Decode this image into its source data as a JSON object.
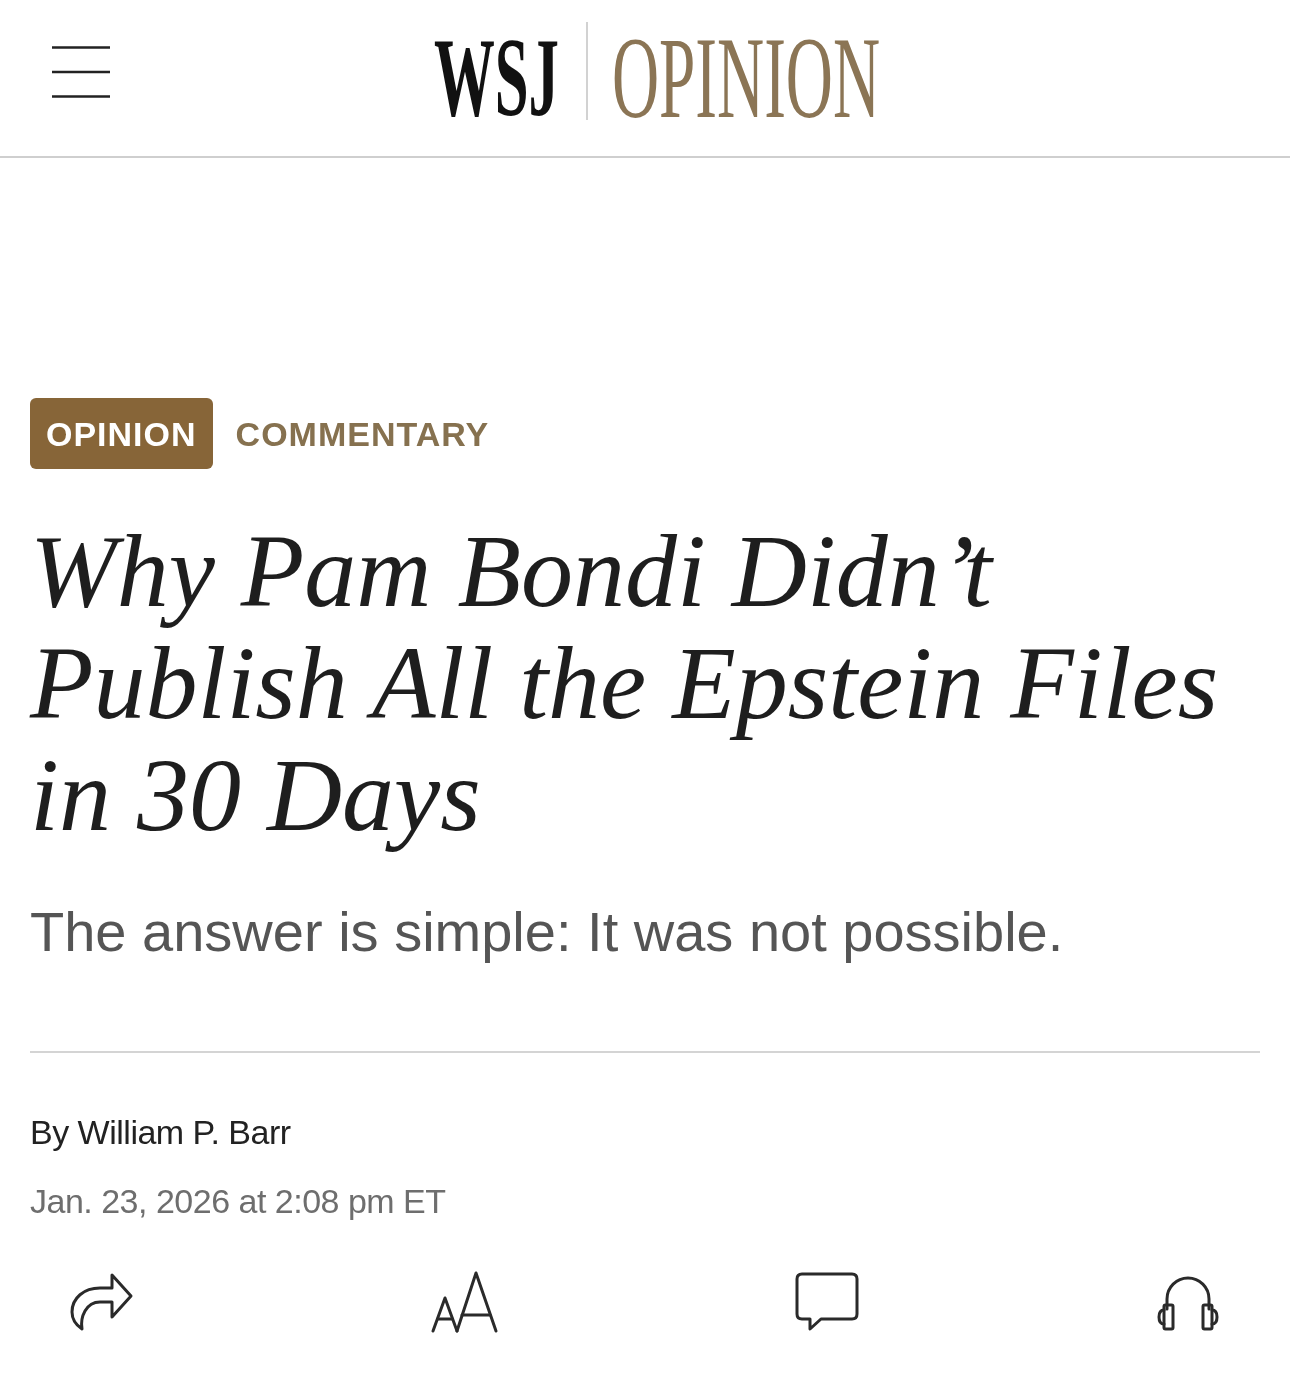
{
  "header": {
    "logo": "WSJ",
    "section": "OPINION"
  },
  "tags": [
    {
      "label": "OPINION",
      "kind": "badge"
    },
    {
      "label": "COMMENTARY",
      "kind": "plain"
    }
  ],
  "headline": "Why Pam Bondi Didn’t Publish All the Epstein Files in 30 Days",
  "subheadline": "The answer is simple: It was not possible.",
  "byline": "By William P. Barr",
  "timestamp": "Jan. 23, 2026 at 2:08 pm ET"
}
